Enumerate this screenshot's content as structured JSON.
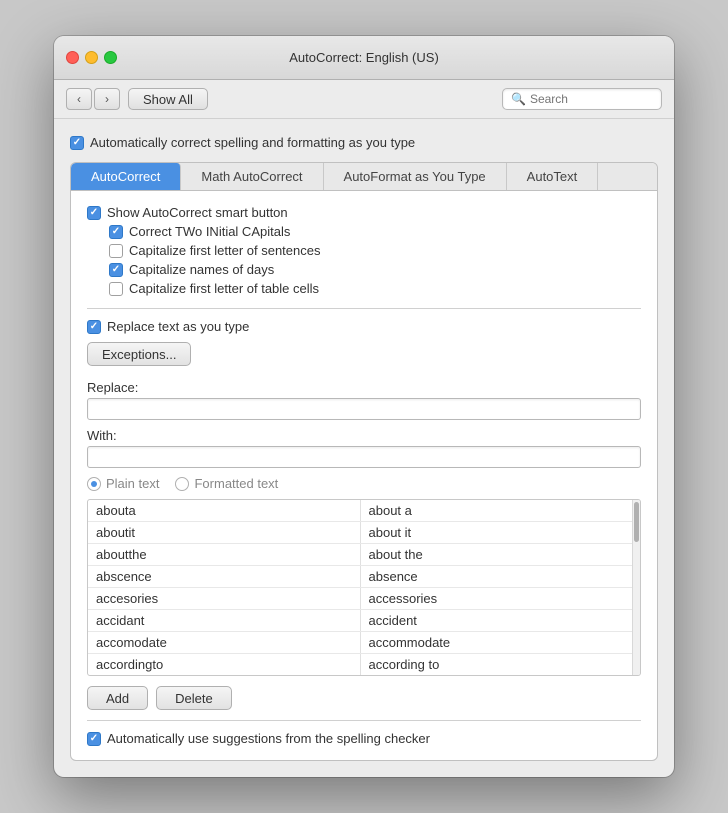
{
  "window": {
    "title": "AutoCorrect: English (US)"
  },
  "toolbar": {
    "show_all_label": "Show All",
    "search_placeholder": "Search"
  },
  "main_checkbox": {
    "label": "Automatically correct spelling and formatting as you type",
    "checked": true
  },
  "tabs": [
    {
      "id": "autocorrect",
      "label": "AutoCorrect",
      "active": true
    },
    {
      "id": "math",
      "label": "Math AutoCorrect",
      "active": false
    },
    {
      "id": "autoformat",
      "label": "AutoFormat as You Type",
      "active": false
    },
    {
      "id": "autotext",
      "label": "AutoText",
      "active": false
    }
  ],
  "autocorrect_options": [
    {
      "label": "Show AutoCorrect smart button",
      "checked": true,
      "indent": false
    },
    {
      "label": "Correct TWo INitial CApitals",
      "checked": true,
      "indent": true
    },
    {
      "label": "Capitalize first letter of sentences",
      "checked": false,
      "indent": true
    },
    {
      "label": "Capitalize names of days",
      "checked": true,
      "indent": true
    },
    {
      "label": "Capitalize first letter of table cells",
      "checked": false,
      "indent": true
    }
  ],
  "replace_checkbox": {
    "label": "Replace text as you type",
    "checked": true
  },
  "exceptions_btn": "Exceptions...",
  "replace_label": "Replace:",
  "with_label": "With:",
  "radio_options": [
    {
      "label": "Plain text",
      "selected": true
    },
    {
      "label": "Formatted text",
      "selected": false
    }
  ],
  "table_rows": [
    {
      "replace": "abouta",
      "with": "about a"
    },
    {
      "replace": "aboutit",
      "with": "about it"
    },
    {
      "replace": "aboutthe",
      "with": "about the"
    },
    {
      "replace": "abscence",
      "with": "absence"
    },
    {
      "replace": "accesories",
      "with": "accessories"
    },
    {
      "replace": "accidant",
      "with": "accident"
    },
    {
      "replace": "accomodate",
      "with": "accommodate"
    },
    {
      "replace": "accordingto",
      "with": "according to"
    }
  ],
  "buttons": {
    "add": "Add",
    "delete": "Delete"
  },
  "bottom_checkbox": {
    "label": "Automatically use suggestions from the spelling checker",
    "checked": true
  }
}
